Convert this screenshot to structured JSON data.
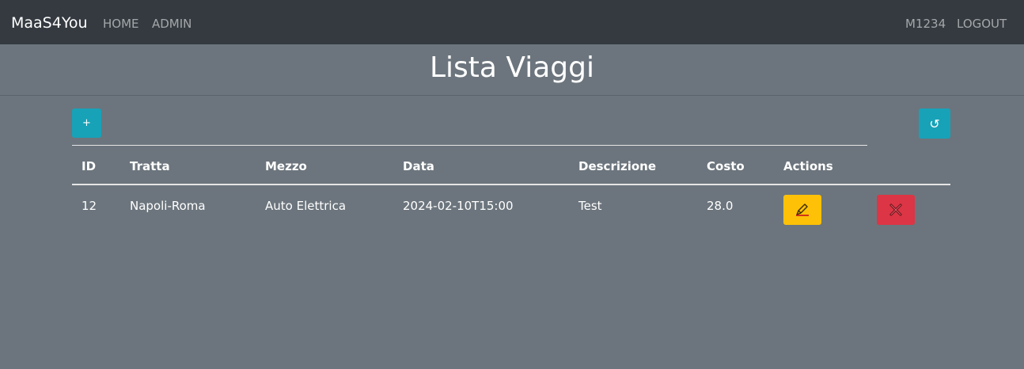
{
  "navbar": {
    "brand": "MaaS4You",
    "links": [
      "HOME",
      "ADMIN"
    ],
    "user": "M1234",
    "logout": "LOGOUT"
  },
  "page": {
    "title": "Lista Viaggi"
  },
  "toolbar": {
    "add_label": "+",
    "refresh_label": "↺"
  },
  "table": {
    "columns": [
      "ID",
      "Tratta",
      "Mezzo",
      "Data",
      "Descrizione",
      "Costo",
      "Actions"
    ],
    "rows": [
      {
        "id": "12",
        "tratta": "Napoli-Roma",
        "mezzo": "Auto Elettrica",
        "data": "2024-02-10T15:00",
        "descrizione": "Test",
        "costo": "28.0",
        "actions": [
          {
            "icon": "pencil-icon",
            "color": "#ffc107"
          },
          {
            "icon": "close-icon",
            "color": "#dc3545"
          }
        ]
      }
    ]
  },
  "colors": {
    "navbar_bg": "#343a40",
    "page_bg": "#6c757d",
    "info": "#17a2b8",
    "warning": "#ffc107",
    "danger": "#dc3545"
  }
}
